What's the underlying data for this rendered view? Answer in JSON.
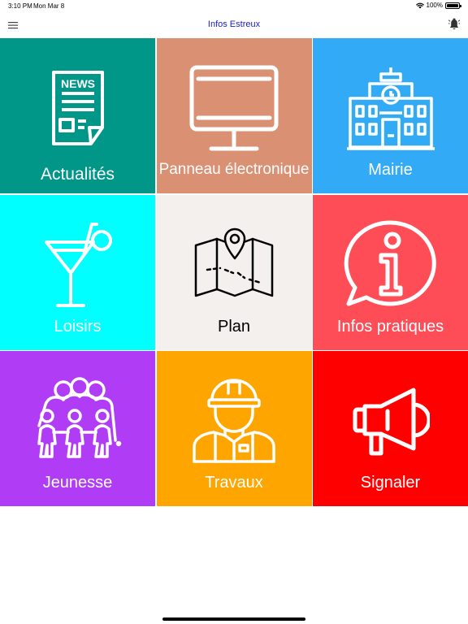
{
  "status_bar": {
    "time": "3:10 PM",
    "date": "Mon Mar 8",
    "battery": "100%",
    "wifi_icon": "wifi-icon",
    "battery_icon": "battery-icon"
  },
  "header": {
    "title": "Infos Estreux",
    "menu_icon": "hamburger-menu-icon",
    "notification_icon": "bell-icon"
  },
  "tiles": [
    {
      "label": "Actualités",
      "icon": "newspaper-icon",
      "color": "#009688",
      "text_color": "#ffffff",
      "icon_text": "NEWS"
    },
    {
      "label": "Panneau électronique",
      "icon": "monitor-icon",
      "color": "#d99073",
      "text_color": "#ffffff"
    },
    {
      "label": "Mairie",
      "icon": "town-hall-icon",
      "color": "#33aaf5",
      "text_color": "#ffffff"
    },
    {
      "label": "Loisirs",
      "icon": "cocktail-icon",
      "color": "#00ffff",
      "text_color": "#ffffff"
    },
    {
      "label": "Plan",
      "icon": "map-icon",
      "color": "#f3f0ee",
      "text_color": "#000000"
    },
    {
      "label": "Infos pratiques",
      "icon": "info-bubble-icon",
      "color": "#ff4d58",
      "text_color": "#ffffff"
    },
    {
      "label": "Jeunesse",
      "icon": "youth-group-icon",
      "color": "#b03df5",
      "text_color": "#ffffff"
    },
    {
      "label": "Travaux",
      "icon": "construction-worker-icon",
      "color": "#ffa500",
      "text_color": "#ffffff"
    },
    {
      "label": "Signaler",
      "icon": "megaphone-icon",
      "color": "#ff0000",
      "text_color": "#ffffff"
    }
  ]
}
